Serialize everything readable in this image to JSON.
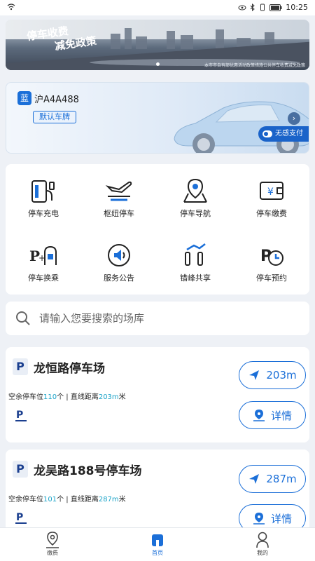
{
  "status_bar": {
    "time": "10:25"
  },
  "banner": {
    "slogan_line1": "停车收费",
    "slogan_line2": "减免政策",
    "caption": "本市市自有部优惠活动政策措施公共停车收费减免政策"
  },
  "vehicle": {
    "plate_color": "蓝",
    "plate_number": "沪A4A488",
    "default_label": "默认车牌",
    "no_sense_pay_label": "无感支付"
  },
  "services": [
    {
      "label": "停车充电",
      "icon": "charging-icon"
    },
    {
      "label": "枢纽停车",
      "icon": "airport-parking-icon"
    },
    {
      "label": "停车导航",
      "icon": "map-navigation-icon"
    },
    {
      "label": "停车缴费",
      "icon": "wallet-payment-icon"
    },
    {
      "label": "停车换乘",
      "icon": "park-and-ride-icon"
    },
    {
      "label": "服务公告",
      "icon": "announcement-icon"
    },
    {
      "label": "错峰共享",
      "icon": "shared-parking-icon"
    },
    {
      "label": "停车预约",
      "icon": "reservation-icon"
    }
  ],
  "search": {
    "placeholder": "请输入您要搜索的场库"
  },
  "lots": [
    {
      "badge": "P",
      "name": "龙恒路停车场",
      "info_prefix": "空余停车位",
      "free_spaces": "110",
      "info_mid": "个 | 直线距离",
      "distance_value": "203m",
      "info_suffix": "米",
      "distance_button": "203m",
      "detail_button": "详情"
    },
    {
      "badge": "P",
      "name": "龙吴路188号停车场",
      "info_prefix": "空余停车位",
      "free_spaces": "101",
      "info_mid": "个 | 直线距离",
      "distance_value": "287m",
      "info_suffix": "米",
      "distance_button": "287m",
      "detail_button": "详情"
    }
  ],
  "tabs": [
    {
      "label": "缴费",
      "icon": "location-pin-icon",
      "active": false
    },
    {
      "label": "首页",
      "icon": "home-icon",
      "active": true
    },
    {
      "label": "我的",
      "icon": "person-icon",
      "active": false
    }
  ],
  "colors": {
    "accent": "#1b6fd8",
    "highlight": "#1aa3c8",
    "background": "#eef1f6"
  }
}
